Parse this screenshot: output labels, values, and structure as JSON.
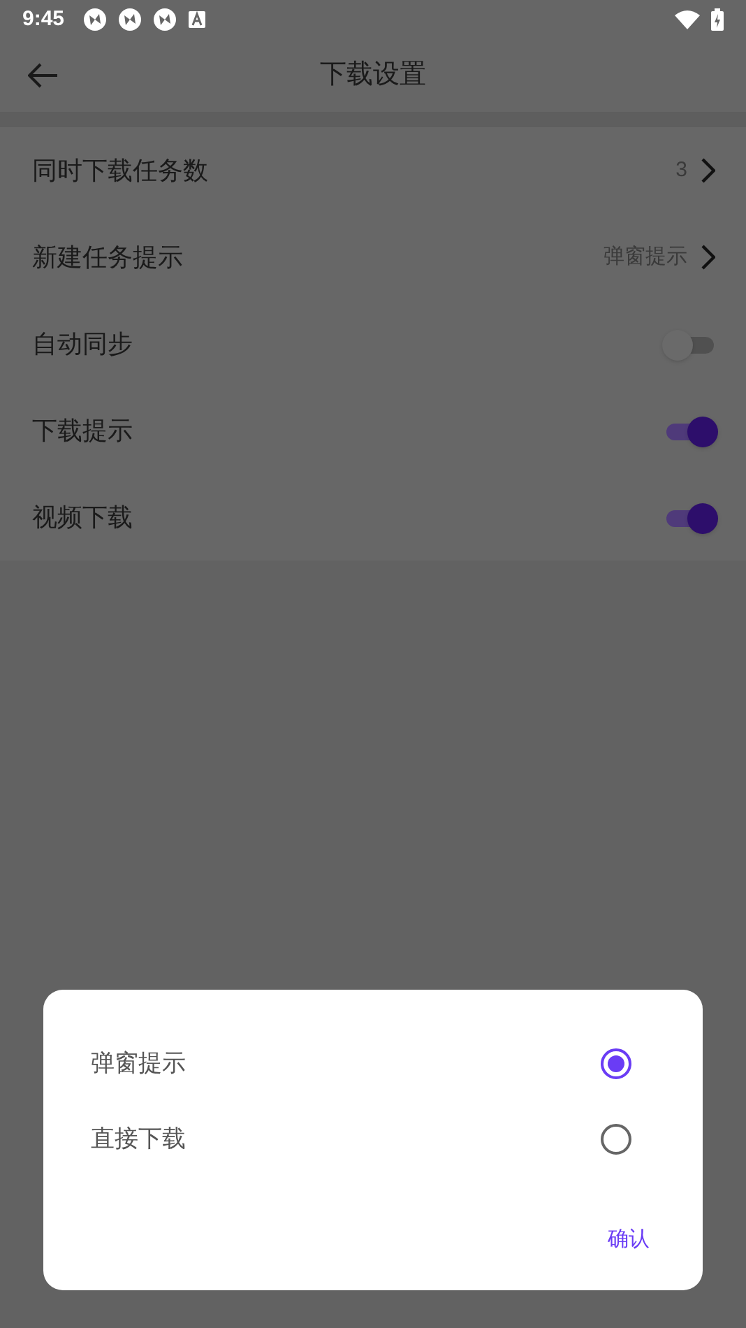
{
  "status_bar": {
    "time": "9:45"
  },
  "header": {
    "title": "下载设置"
  },
  "settings": [
    {
      "kind": "nav",
      "label": "同时下载任务数",
      "value": "3"
    },
    {
      "kind": "nav",
      "label": "新建任务提示",
      "value": "弹窗提示"
    },
    {
      "kind": "toggle",
      "label": "自动同步",
      "on": false
    },
    {
      "kind": "toggle",
      "label": "下载提示",
      "on": true
    },
    {
      "kind": "toggle",
      "label": "视频下载",
      "on": true
    }
  ],
  "dialog": {
    "options": [
      {
        "label": "弹窗提示",
        "selected": true
      },
      {
        "label": "直接下载",
        "selected": false
      }
    ],
    "confirm": "确认"
  }
}
